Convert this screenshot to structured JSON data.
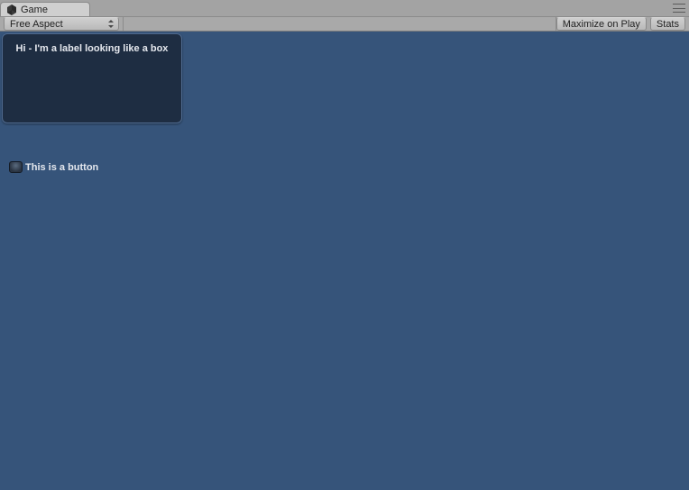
{
  "tab": {
    "title": "Game"
  },
  "toolbar": {
    "aspect_selected": "Free Aspect",
    "maximize_label": "Maximize on Play",
    "stats_label": "Stats"
  },
  "gui": {
    "box_label_text": "Hi - I'm a label looking like a box",
    "toggle_label": "This is a button"
  }
}
